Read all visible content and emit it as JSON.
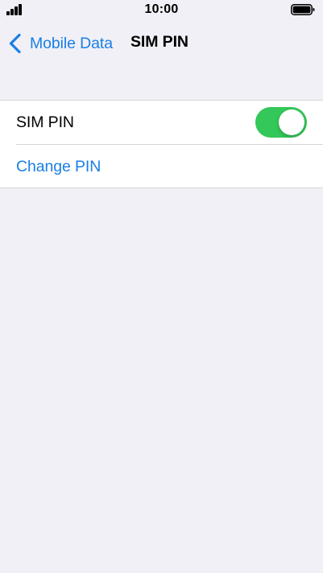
{
  "status_bar": {
    "time": "10:00",
    "signal_icon": "signal-bars-icon",
    "battery_icon": "battery-full-icon"
  },
  "nav": {
    "back_label": "Mobile Data",
    "title": "SIM PIN",
    "back_icon": "chevron-left-icon"
  },
  "settings": {
    "sim_pin": {
      "label": "SIM PIN",
      "enabled": true
    },
    "change_pin": {
      "label": "Change PIN"
    }
  },
  "colors": {
    "accent": "#1a7ee6",
    "toggle_on": "#34c759",
    "background": "#f0f0f6"
  }
}
